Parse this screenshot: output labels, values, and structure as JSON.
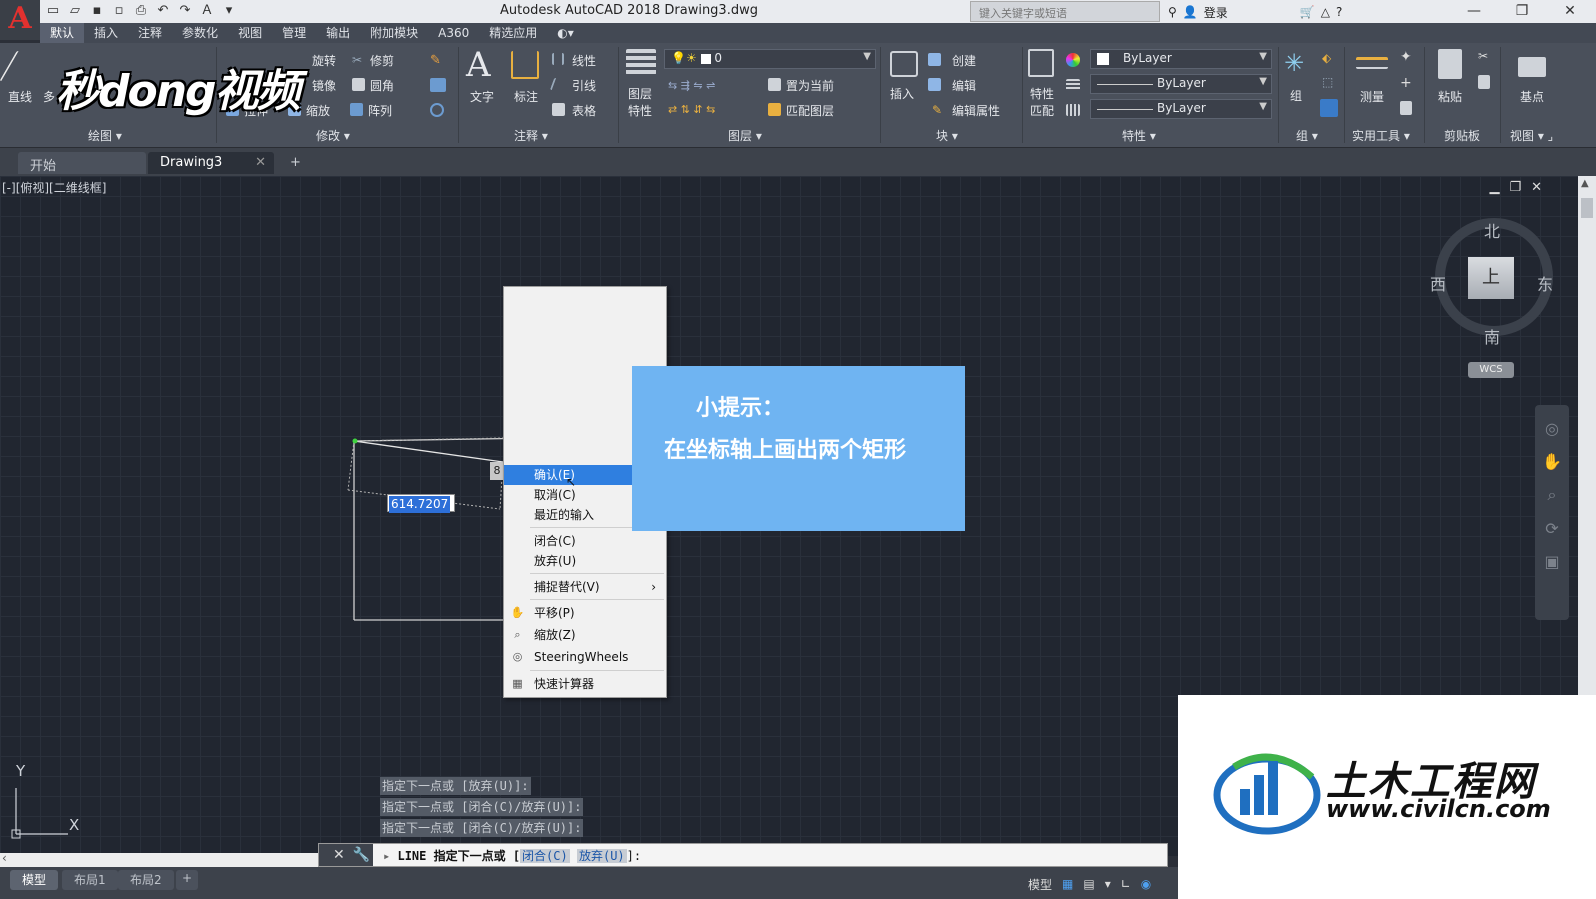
{
  "app": {
    "logo": "A",
    "title": "Autodesk AutoCAD 2018    Drawing3.dwg",
    "search_placeholder": "键入关键字或短语",
    "login": "登录",
    "help": "?"
  },
  "window_controls": [
    "—",
    "❐",
    "✕"
  ],
  "ribbon_tabs": [
    {
      "label": "默认",
      "active": true
    },
    {
      "label": "插入"
    },
    {
      "label": "注释"
    },
    {
      "label": "参数化"
    },
    {
      "label": "视图"
    },
    {
      "label": "管理"
    },
    {
      "label": "输出"
    },
    {
      "label": "附加模块"
    },
    {
      "label": "A360"
    },
    {
      "label": "精选应用"
    }
  ],
  "ribbon": {
    "draw": {
      "line": "直线",
      "poly": "多",
      "label": "绘图"
    },
    "modify": {
      "rotate": "旋转",
      "trim": "修剪",
      "mirror": "镜像",
      "fillet": "圆角",
      "stretch": "拉伸",
      "scale": "缩放",
      "array": "阵列",
      "label": "修改"
    },
    "annotation": {
      "text": "文字",
      "dim": "标注",
      "linear": "线性",
      "leader": "引线",
      "table": "表格",
      "label": "注释"
    },
    "layers": {
      "props_1": "图层",
      "props_2": "特性",
      "current_layer": "0",
      "set_current": "置为当前",
      "match_layer": "匹配图层",
      "label": "图层"
    },
    "block": {
      "insert": "插入",
      "create": "创建",
      "edit": "编辑",
      "edit_attr": "编辑属性",
      "label": "块"
    },
    "properties": {
      "match_1": "特性",
      "match_2": "匹配",
      "color": "ByLayer",
      "linetype": "ByLayer",
      "lineweight": "ByLayer",
      "label": "特性"
    },
    "groups": {
      "group": "组",
      "label": "组"
    },
    "utilities": {
      "measure": "测量",
      "label": "实用工具"
    },
    "clipboard": {
      "paste": "粘贴",
      "label": "剪贴板"
    },
    "view": {
      "base": "基点",
      "label": "视图"
    }
  },
  "watermark_top": "秒dong视频",
  "doc_tabs": [
    {
      "label": "开始"
    },
    {
      "label": "Drawing3",
      "active": true
    }
  ],
  "doc_tab_add": "+",
  "viewport": {
    "label": "[-][俯视][二维线框]"
  },
  "viewcube": {
    "face": "上",
    "north": "北",
    "south": "南",
    "east": "东",
    "west": "西",
    "wcs": "WCS"
  },
  "dynamic_input": {
    "value": "614.7207",
    "small": "8"
  },
  "context_menu": [
    {
      "label": "确认(E)",
      "highlighted": true,
      "icon": ""
    },
    {
      "label": "取消(C)",
      "icon": ""
    },
    {
      "label": "最近的输入",
      "icon": ""
    },
    {
      "label": "闭合(C)",
      "icon": ""
    },
    {
      "label": "放弃(U)",
      "icon": ""
    },
    {
      "label": "捕捉替代(V)",
      "icon": "",
      "submenu": true
    },
    {
      "label": "平移(P)",
      "icon": "pan-icon"
    },
    {
      "label": "缩放(Z)",
      "icon": "zoom-icon"
    },
    {
      "label": "SteeringWheels",
      "icon": "steeringwheel-icon"
    },
    {
      "label": "快速计算器",
      "icon": "calculator-icon"
    }
  ],
  "tip": {
    "title": "小提示：",
    "text": "在坐标轴上画出两个矩形"
  },
  "ucs": {
    "x": "X",
    "y": "Y"
  },
  "command_history": [
    "指定下一点或 [放弃(U)]:",
    "指定下一点或 [闭合(C)/放弃(U)]:",
    "指定下一点或 [闭合(C)/放弃(U)]:"
  ],
  "command_line": {
    "prefix": "LINE 指定下一点或 [",
    "opt_close": "闭合(C)",
    "opt_undo": "放弃(U)",
    "suffix": "]:"
  },
  "layout_tabs": [
    {
      "label": "模型",
      "active": true
    },
    {
      "label": "布局1"
    },
    {
      "label": "布局2"
    }
  ],
  "layout_tab_add": "+",
  "status": {
    "model": "模型"
  },
  "site_logo": {
    "name": "土木工程网",
    "url": "www.civilcn.com"
  },
  "colors": {
    "accent": "#2f7fe0",
    "tip_bg": "#6fb4f2",
    "canvas": "#212630"
  }
}
